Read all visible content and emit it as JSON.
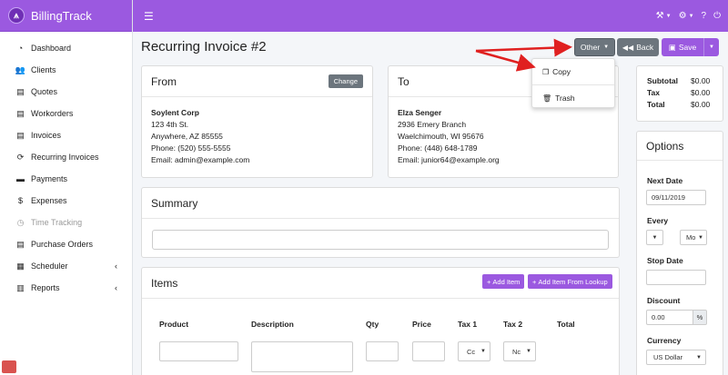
{
  "brand": {
    "name": "BillingTrack"
  },
  "sidebar": {
    "items": [
      {
        "label": "Dashboard",
        "icon": "dashboard-icon"
      },
      {
        "label": "Clients",
        "icon": "users-icon"
      },
      {
        "label": "Quotes",
        "icon": "file-icon"
      },
      {
        "label": "Workorders",
        "icon": "file-icon"
      },
      {
        "label": "Invoices",
        "icon": "file-icon"
      },
      {
        "label": "Recurring Invoices",
        "icon": "sync-icon"
      },
      {
        "label": "Payments",
        "icon": "credit-card-icon"
      },
      {
        "label": "Expenses",
        "icon": "dollar-icon"
      },
      {
        "label": "Time Tracking",
        "icon": "clock-icon"
      },
      {
        "label": "Purchase Orders",
        "icon": "file-icon"
      },
      {
        "label": "Scheduler",
        "icon": "calendar-icon"
      },
      {
        "label": "Reports",
        "icon": "chart-icon"
      }
    ]
  },
  "page": {
    "title": "Recurring Invoice #2"
  },
  "toolbar": {
    "other_label": "Other",
    "back_label": "Back",
    "save_label": "Save"
  },
  "other_menu": {
    "copy_label": "Copy",
    "trash_label": "Trash"
  },
  "from": {
    "title": "From",
    "change_label": "Change",
    "name": "Soylent Corp",
    "street": "123 4th St.",
    "city": "Anywhere, AZ 85555",
    "phone": "Phone: (520) 555-5555",
    "email": "Email: admin@example.com"
  },
  "to": {
    "title": "To",
    "name": "Elza Senger",
    "street": "2936 Emery Branch",
    "city": "Waelchimouth, WI 95676",
    "phone": "Phone: (448) 648-1789",
    "email": "Email: junior64@example.org"
  },
  "totals": {
    "subtotal_label": "Subtotal",
    "subtotal": "$0.00",
    "tax_label": "Tax",
    "tax": "$0.00",
    "total_label": "Total",
    "total": "$0.00"
  },
  "options": {
    "title": "Options",
    "next_date_label": "Next Date",
    "next_date": "09/11/2019",
    "every_label": "Every",
    "every_unit": "Mo",
    "stop_date_label": "Stop Date",
    "discount_label": "Discount",
    "discount": "0.00",
    "discount_unit": "%",
    "currency_label": "Currency",
    "currency": "US Dollar"
  },
  "summary": {
    "title": "Summary"
  },
  "items": {
    "title": "Items",
    "add_item_label": "Add Item",
    "add_lookup_label": "Add Item From Lookup",
    "columns": [
      "Product",
      "Description",
      "Qty",
      "Price",
      "Tax 1",
      "Tax 2",
      "Total"
    ],
    "tax1_value": "Cc",
    "tax2_value": "Nc"
  },
  "colors": {
    "accent": "#9b59e0",
    "secondary": "#6c757d",
    "annotation_arrow": "#e02020"
  }
}
